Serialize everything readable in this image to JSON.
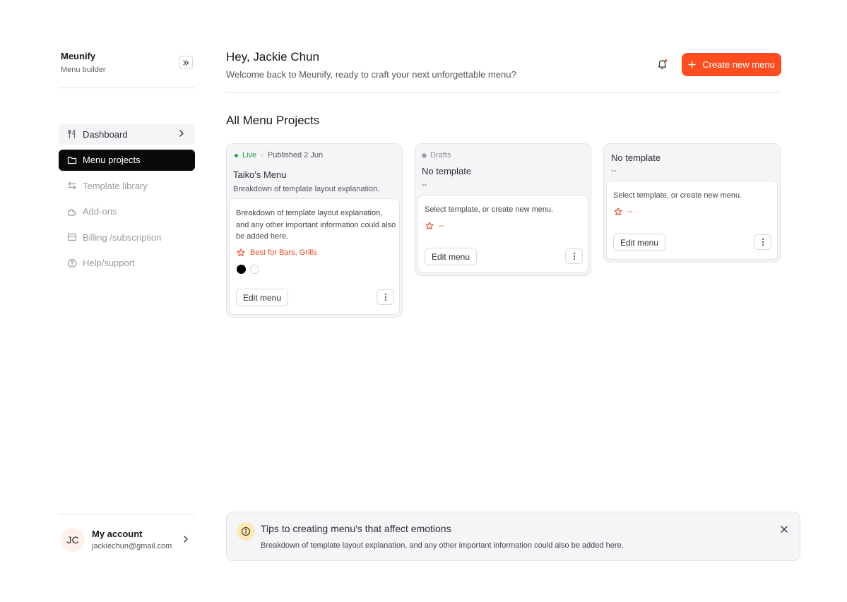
{
  "sidebar": {
    "brand_name": "Meunify",
    "brand_sub": "Menu builder",
    "nav": [
      {
        "label": "Dashboard"
      },
      {
        "label": "Menu projects"
      },
      {
        "label": "Template library"
      },
      {
        "label": "Add-ons"
      },
      {
        "label": "Billing /subscription"
      },
      {
        "label": "Help/support"
      }
    ],
    "account": {
      "initials": "JC",
      "name": "My account",
      "email": "jackiechun@gmail.com"
    }
  },
  "header": {
    "greeting": "Hey, Jackie Chun",
    "welcome": "Welcome back to Meunify, ready to craft your next unforgettable menu?",
    "create_label": "Create new menu"
  },
  "projects": {
    "title": "All Menu Projects",
    "cards": [
      {
        "status": "Live",
        "published": "Published 2 Jun",
        "title": "Taiko's Menu",
        "subtitle": "Breakdown of template layout explanation.",
        "description": "Breakdown of template layout explanation, and any other important information could also be added here.",
        "tag": "Best for Bars, Grills",
        "edit_label": "Edit menu"
      },
      {
        "status": "Drafts",
        "title": "No template",
        "subtitle": "--",
        "description": "Select template, or create new menu.",
        "tag": "--",
        "edit_label": "Edit menu"
      },
      {
        "title": "No template",
        "subtitle": "--",
        "description": "Select template, or create new menu.",
        "tag": "--",
        "edit_label": "Edit menu"
      }
    ]
  },
  "tips": {
    "title": "Tips to creating menu's that affect emotions",
    "body": "Breakdown of template layout explanation, and any other important information could also be added here."
  },
  "colors": {
    "accent": "#ff4d1f",
    "live": "#22a447",
    "tag": "#ea4b23"
  }
}
